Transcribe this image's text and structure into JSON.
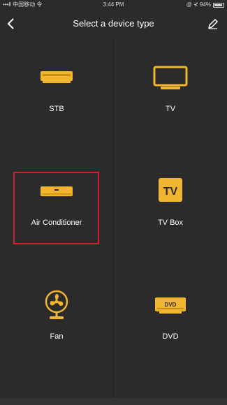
{
  "status_bar": {
    "carrier": "•••ll 中国移动 令",
    "time": "3:44 PM",
    "battery_text": "@ ⊀ 94%"
  },
  "nav": {
    "title": "Select a device type",
    "back_icon": "chevron-left-icon",
    "edit_icon": "pencil-icon"
  },
  "devices": [
    {
      "label": "STB",
      "icon": "set-top-box-icon",
      "selected": false
    },
    {
      "label": "TV",
      "icon": "tv-icon",
      "selected": false
    },
    {
      "label": "Air Conditioner",
      "icon": "air-conditioner-icon",
      "selected": true
    },
    {
      "label": "TV Box",
      "icon": "tv-box-icon",
      "selected": false
    },
    {
      "label": "Fan",
      "icon": "fan-icon",
      "selected": false
    },
    {
      "label": "DVD",
      "icon": "dvd-icon",
      "selected": false
    }
  ],
  "colors": {
    "background": "#2b2b2b",
    "icon_accent": "#f2b530",
    "highlight_border": "#d0202a",
    "text": "#ffffff"
  }
}
